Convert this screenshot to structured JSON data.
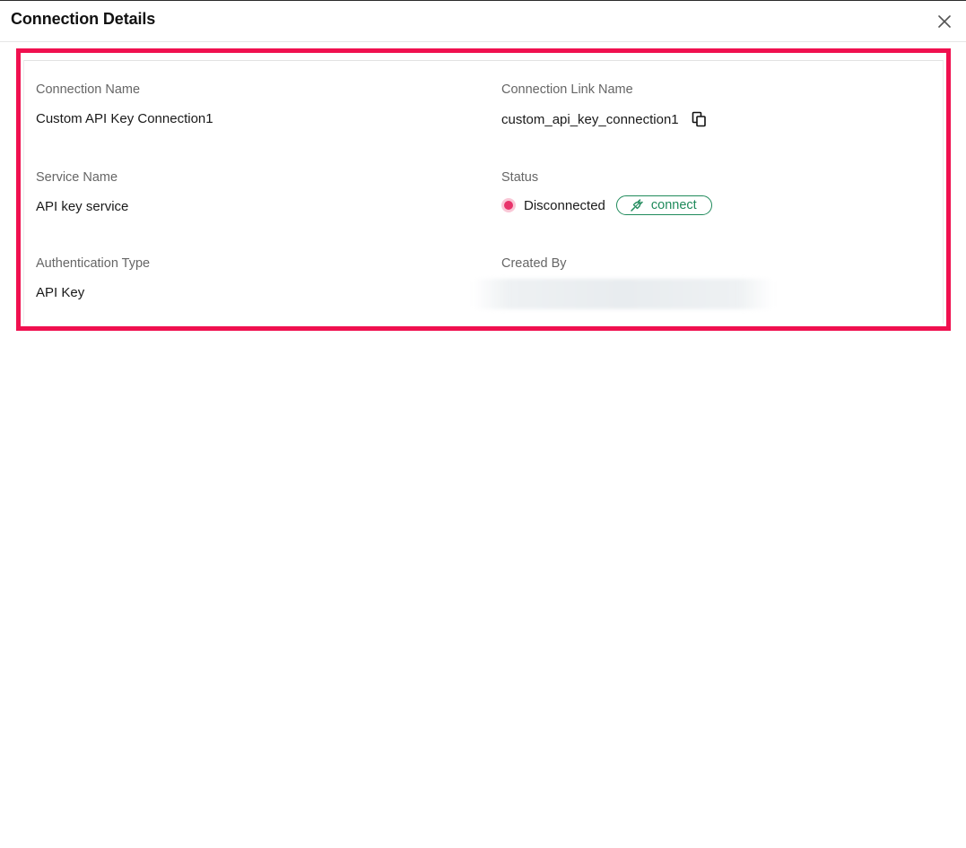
{
  "dialog": {
    "title": "Connection Details"
  },
  "fields": {
    "connection_name": {
      "label": "Connection Name",
      "value": "Custom API Key Connection1"
    },
    "connection_link_name": {
      "label": "Connection Link Name",
      "value": "custom_api_key_connection1"
    },
    "service_name": {
      "label": "Service Name",
      "value": "API key service"
    },
    "status": {
      "label": "Status",
      "value": "Disconnected",
      "action_label": "connect",
      "status_color": "#e8336a",
      "action_color": "#1f8a5b"
    },
    "authentication_type": {
      "label": "Authentication Type",
      "value": "API Key"
    },
    "created_by": {
      "label": "Created By"
    }
  },
  "icons": {
    "close": "close-icon",
    "copy": "copy-icon",
    "plug": "plug-icon"
  },
  "colors": {
    "highlight_frame": "#f0104f"
  }
}
